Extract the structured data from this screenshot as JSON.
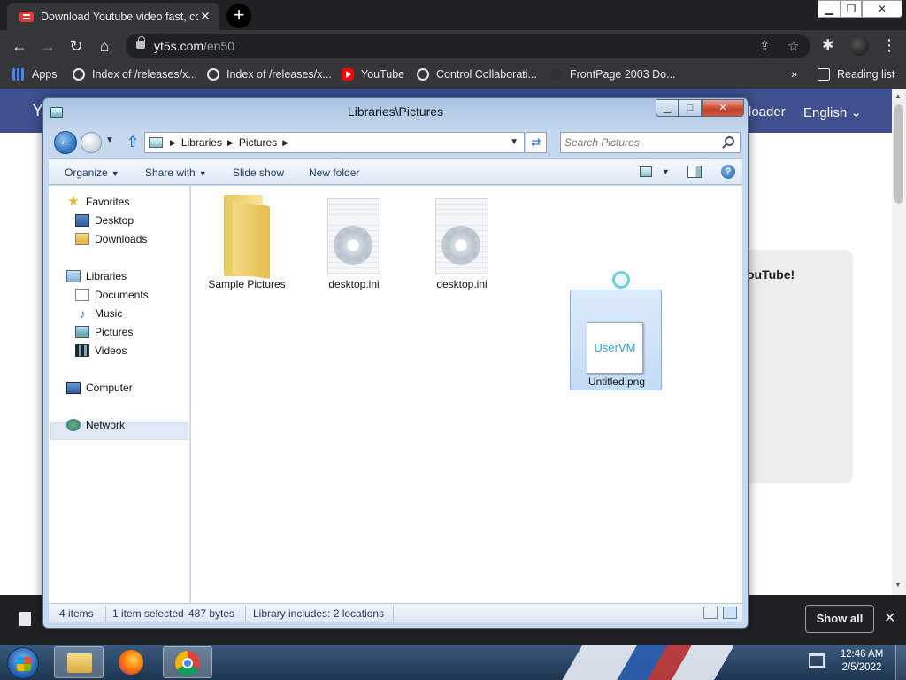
{
  "browser": {
    "tab_title": "Download Youtube video fast, co",
    "new_tab_symbol": "+",
    "url_domain": "yt5s.com",
    "url_path": "/en50",
    "bookmarks": [
      "Apps",
      "Index of /releases/x...",
      "Index of /releases/x...",
      "YouTube",
      "Control Collaborati...",
      "FrontPage 2003 Do..."
    ],
    "bookmarks_overflow": "»",
    "reading_list": "Reading list"
  },
  "website": {
    "logo_partial": "Y",
    "nav_partial": "loader",
    "language": "English",
    "card_title_partial": "ouTube!"
  },
  "download_bar": {
    "show_all": "Show all"
  },
  "taskbar": {
    "time": "12:46 AM",
    "date": "2/5/2022"
  },
  "explorer": {
    "title": "Libraries\\Pictures",
    "breadcrumbs": [
      "Libraries",
      "Pictures"
    ],
    "search_placeholder": "Search Pictures",
    "commands": {
      "organize": "Organize",
      "share_with": "Share with",
      "slide_show": "Slide show",
      "new_folder": "New folder"
    },
    "nav": {
      "favorites": "Favorites",
      "desktop": "Desktop",
      "downloads": "Downloads",
      "libraries": "Libraries",
      "documents": "Documents",
      "music": "Music",
      "pictures": "Pictures",
      "videos": "Videos",
      "computer": "Computer",
      "network": "Network"
    },
    "files": [
      {
        "name": "Sample Pictures",
        "type": "folder"
      },
      {
        "name": "desktop.ini",
        "type": "ini"
      },
      {
        "name": "desktop.ini",
        "type": "ini"
      },
      {
        "name": "Untitled.png",
        "type": "png",
        "thumb_text": "UserVM",
        "selected": true
      }
    ],
    "status": {
      "items": "4 items",
      "selected": "1 item selected",
      "size": "487 bytes",
      "library": "Library includes: 2 locations"
    }
  },
  "icons": {
    "back": "arrow-left",
    "forward": "arrow-right",
    "reload": "reload",
    "home": "home",
    "share": "share",
    "star": "star",
    "extensions": "puzzle",
    "menu": "kebab"
  }
}
